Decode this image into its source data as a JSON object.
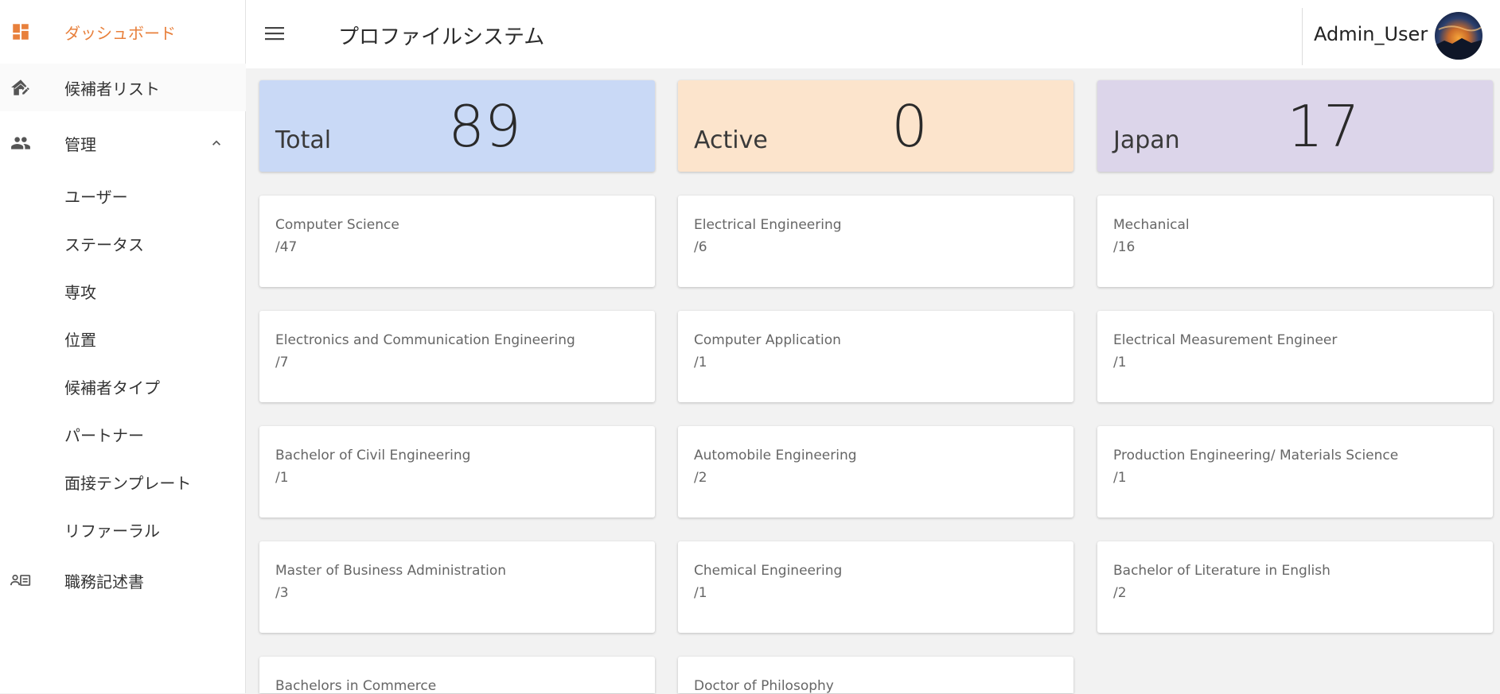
{
  "sidebar": {
    "dashboard": "ダッシュボード",
    "candidate_list": "候補者リスト",
    "management": "管理",
    "sub_items": [
      "ユーザー",
      "ステータス",
      "専攻",
      "位置",
      "候補者タイプ",
      "パートナー",
      "面接テンプレート",
      "リファーラル"
    ],
    "job_description": "職務記述書"
  },
  "header": {
    "title": "プロファイルシステム",
    "user_name": "Admin_User"
  },
  "stats": [
    {
      "label": "Total",
      "value": "89",
      "color": "#c9d9f6"
    },
    {
      "label": "Active",
      "value": "0",
      "color": "#fce4cc"
    },
    {
      "label": "Japan",
      "value": "17",
      "color": "#dcd5ea"
    }
  ],
  "categories": [
    {
      "name": "Computer Science",
      "count": "/47"
    },
    {
      "name": "Electrical Engineering",
      "count": "/6"
    },
    {
      "name": "Mechanical",
      "count": "/16"
    },
    {
      "name": "Electronics and Communication Engineering",
      "count": "/7"
    },
    {
      "name": "Computer Application",
      "count": "/1"
    },
    {
      "name": "Electrical Measurement Engineer",
      "count": "/1"
    },
    {
      "name": "Bachelor of Civil Engineering",
      "count": "/1"
    },
    {
      "name": "Automobile Engineering",
      "count": "/2"
    },
    {
      "name": "Production Engineering/ Materials Science",
      "count": "/1"
    },
    {
      "name": "Master of Business Administration",
      "count": "/3"
    },
    {
      "name": "Chemical Engineering",
      "count": "/1"
    },
    {
      "name": "Bachelor of Literature in English",
      "count": "/2"
    },
    {
      "name": "Bachelors in Commerce",
      "count": ""
    },
    {
      "name": "Doctor of Philosophy",
      "count": ""
    }
  ],
  "icons": {
    "dashboard": "dashboard-icon",
    "candidate_list": "house-edit-icon",
    "management": "people-icon",
    "job_description": "person-card-icon",
    "menu": "hamburger-menu-icon",
    "expand": "chevron-up-icon"
  },
  "colors": {
    "accent": "#e8803c"
  }
}
